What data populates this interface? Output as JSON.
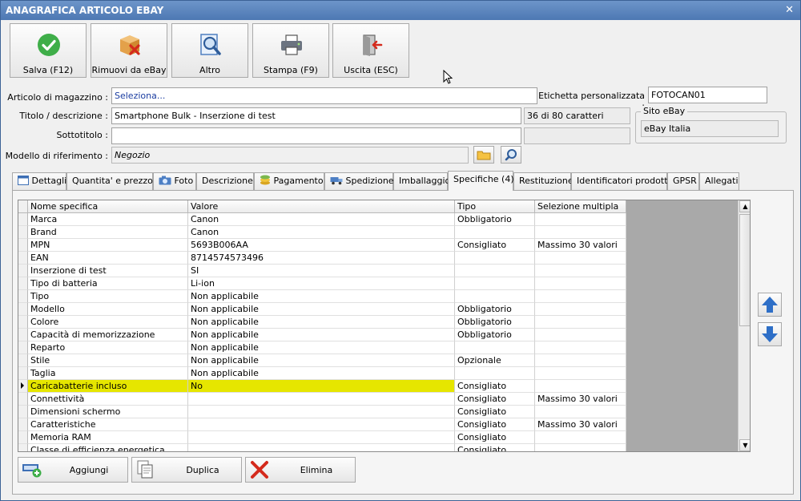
{
  "window": {
    "title": "ANAGRAFICA ARTICOLO EBAY",
    "close_glyph": "✕"
  },
  "toolbar": [
    {
      "label": "Salva (F12)",
      "icon": "check-icon"
    },
    {
      "label": "Rimuovi da eBay",
      "icon": "box-remove-icon"
    },
    {
      "label": "Altro",
      "icon": "magnifier-doc-icon"
    },
    {
      "label": "Stampa (F9)",
      "icon": "printer-icon"
    },
    {
      "label": "Uscita (ESC)",
      "icon": "exit-door-icon"
    }
  ],
  "form": {
    "articolo_label": "Articolo di magazzino :",
    "articolo_placeholder": "Seleziona...",
    "etichetta_label": "Etichetta personalizzata :",
    "etichetta_value": "FOTOCAN01",
    "titolo_label": "Titolo / descrizione :",
    "titolo_value": "Smartphone Bulk - Inserzione di test",
    "titolo_counter": "36 di 80 caratteri",
    "sottotitolo_label": "Sottotitolo :",
    "sottotitolo_value": "",
    "modello_label": "Modello di riferimento :",
    "modello_value": "Negozio",
    "sito_group_title": "Sito eBay",
    "sito_value": "eBay Italia"
  },
  "tabs": [
    {
      "label": "Dettagli",
      "icon": "window-icon"
    },
    {
      "label": "Quantita' e prezzo"
    },
    {
      "label": "Foto",
      "icon": "camera-icon"
    },
    {
      "label": "Descrizione"
    },
    {
      "label": "Pagamento",
      "icon": "coins-icon"
    },
    {
      "label": "Spedizione",
      "icon": "truck-icon"
    },
    {
      "label": "Imballaggio"
    },
    {
      "label": "Specifiche (4)",
      "active": true
    },
    {
      "label": "Restituzione"
    },
    {
      "label": "Identificatori prodotto"
    },
    {
      "label": "GPSR"
    },
    {
      "label": "Allegati"
    }
  ],
  "grid": {
    "columns": [
      "Nome specifica",
      "Valore",
      "Tipo",
      "Selezione multipla"
    ],
    "rows": [
      [
        "Marca",
        "Canon",
        "Obbligatorio",
        ""
      ],
      [
        "Brand",
        "Canon",
        "",
        ""
      ],
      [
        "MPN",
        "5693B006AA",
        "Consigliato",
        "Massimo 30 valori"
      ],
      [
        "EAN",
        "8714574573496",
        "",
        ""
      ],
      [
        "Inserzione di test",
        "SI",
        "",
        ""
      ],
      [
        "Tipo di batteria",
        "Li-ion",
        "",
        ""
      ],
      [
        "Tipo",
        "Non applicabile",
        "",
        ""
      ],
      [
        "Modello",
        "Non applicabile",
        "Obbligatorio",
        ""
      ],
      [
        "Colore",
        "Non applicabile",
        "Obbligatorio",
        ""
      ],
      [
        "Capacità di memorizzazione",
        "Non applicabile",
        "Obbligatorio",
        ""
      ],
      [
        "Reparto",
        "Non applicabile",
        "",
        ""
      ],
      [
        "Stile",
        "Non applicabile",
        "Opzionale",
        ""
      ],
      [
        "Taglia",
        "Non applicabile",
        "",
        ""
      ],
      [
        "Caricabatterie incluso",
        "No",
        "Consigliato",
        ""
      ],
      [
        "Connettività",
        "",
        "Consigliato",
        "Massimo 30 valori"
      ],
      [
        "Dimensioni schermo",
        "",
        "Consigliato",
        ""
      ],
      [
        "Caratteristiche",
        "",
        "Consigliato",
        "Massimo 30 valori"
      ],
      [
        "Memoria RAM",
        "",
        "Consigliato",
        ""
      ],
      [
        "Classe di efficienza energetica",
        "",
        "Consigliato",
        ""
      ]
    ],
    "selected_row": 13
  },
  "bottom_buttons": [
    {
      "label": "Aggiungi",
      "icon": "add-row-icon"
    },
    {
      "label": "Duplica",
      "icon": "duplicate-icon"
    },
    {
      "label": "Elimina",
      "icon": "delete-x-icon"
    }
  ]
}
